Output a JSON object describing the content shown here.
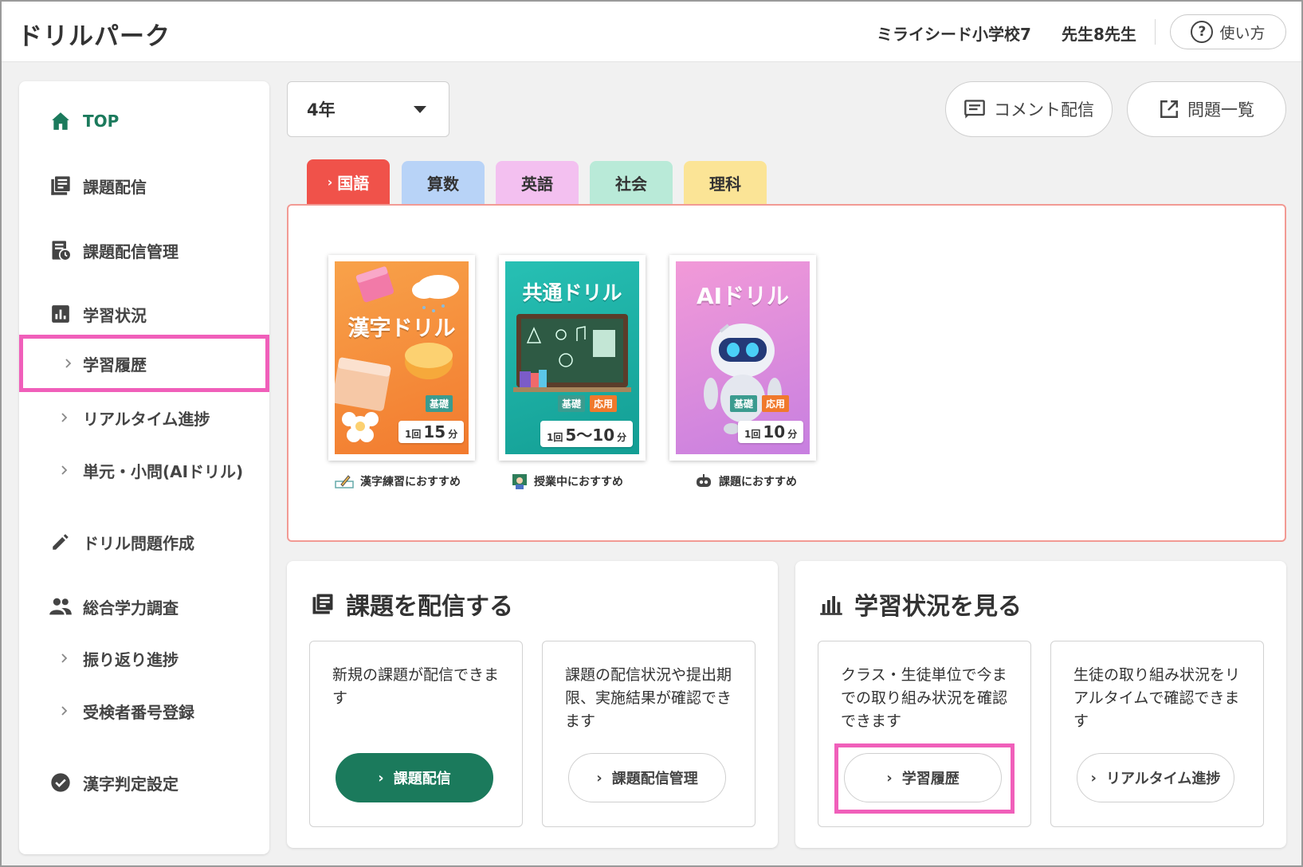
{
  "header": {
    "app_title": "ドリルパーク",
    "school": "ミライシード小学校7",
    "teacher": "先生8先生",
    "help_label": "使い方"
  },
  "sidebar": {
    "top": "TOP",
    "assign": "課題配信",
    "assign_manage": "課題配信管理",
    "study_status": "学習状況",
    "study_history": "学習履歴",
    "realtime": "リアルタイム進捗",
    "unit_ai": "単元・小問(AIドリル)",
    "create_drill": "ドリル問題作成",
    "survey": "総合学力調査",
    "review_progress": "振り返り進捗",
    "examinee_register": "受検者番号登録",
    "kanji_setting": "漢字判定設定"
  },
  "toolbar": {
    "grade": "4年",
    "comment": "コメント配信",
    "problems": "問題一覧"
  },
  "tabs": [
    "国語",
    "算数",
    "英語",
    "社会",
    "理科"
  ],
  "tab_colors": [
    "#f0524a",
    "#b8d3f7",
    "#f3c0f0",
    "#b9ead8",
    "#fbe496"
  ],
  "drills": [
    {
      "title": "漢字ドリル",
      "badges": [
        "基礎"
      ],
      "time_prefix": "1回",
      "time_value": "15",
      "time_unit": "分",
      "caption": "漢字練習におすすめ",
      "color": "#f58a3c"
    },
    {
      "title": "共通ドリル",
      "badges": [
        "基礎",
        "応用"
      ],
      "time_prefix": "1回",
      "time_value": "5〜10",
      "time_unit": "分",
      "caption": "授業中におすすめ",
      "color": "#1fb3a8"
    },
    {
      "title": "AIドリル",
      "badges": [
        "基礎",
        "応用"
      ],
      "time_prefix": "1回",
      "time_value": "10",
      "time_unit": "分",
      "caption": "課題におすすめ",
      "color": "#d98be0"
    }
  ],
  "sections": {
    "assign": {
      "title": "課題を配信する",
      "cards": [
        {
          "desc": "新規の課題が配信できます",
          "button": "課題配信"
        },
        {
          "desc": "課題の配信状況や提出期限、実施結果が確認できます",
          "button": "課題配信管理"
        }
      ]
    },
    "status": {
      "title": "学習状況を見る",
      "cards": [
        {
          "desc": "クラス・生徒単位で今までの取り組み状況を確認できます",
          "button": "学習履歴"
        },
        {
          "desc": "生徒の取り組み状況をリアルタイムで確認できます",
          "button": "リアルタイム進捗"
        }
      ]
    }
  }
}
